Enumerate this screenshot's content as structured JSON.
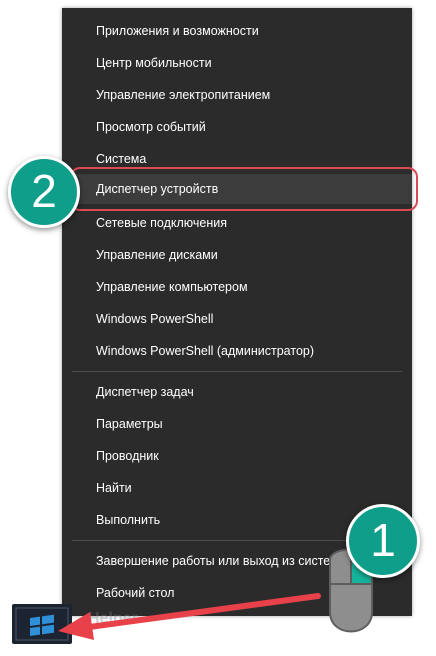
{
  "menu": {
    "items": [
      {
        "label": "Приложения и возможности"
      },
      {
        "label": "Центр мобильности"
      },
      {
        "label": "Управление электропитанием"
      },
      {
        "label": "Просмотр событий"
      },
      {
        "label": "Система"
      },
      {
        "label": "Диспетчер устройств",
        "active": true
      },
      {
        "label": "Сетевые подключения"
      },
      {
        "label": "Управление дисками"
      },
      {
        "label": "Управление компьютером"
      },
      {
        "label": "Windows PowerShell"
      },
      {
        "label": "Windows PowerShell (администратор)"
      },
      {
        "label": "Диспетчер задач"
      },
      {
        "label": "Параметры"
      },
      {
        "label": "Проводник"
      },
      {
        "label": "Найти"
      },
      {
        "label": "Выполнить"
      },
      {
        "label": "Завершение работы или выход из системы"
      },
      {
        "label": "Рабочий стол"
      }
    ]
  },
  "annotations": {
    "step1": "1",
    "step2": "2"
  },
  "watermark": "Helper",
  "colors": {
    "menu_bg": "#2b2b2b",
    "active_bg": "#3c3c3c",
    "badge": "#0f9e8a",
    "highlight": "#d94a55",
    "arrow": "#e8414a"
  },
  "icons": {
    "start": "windows-start-icon",
    "mouse": "mouse-right-click-icon",
    "arrow": "red-arrow-icon"
  }
}
